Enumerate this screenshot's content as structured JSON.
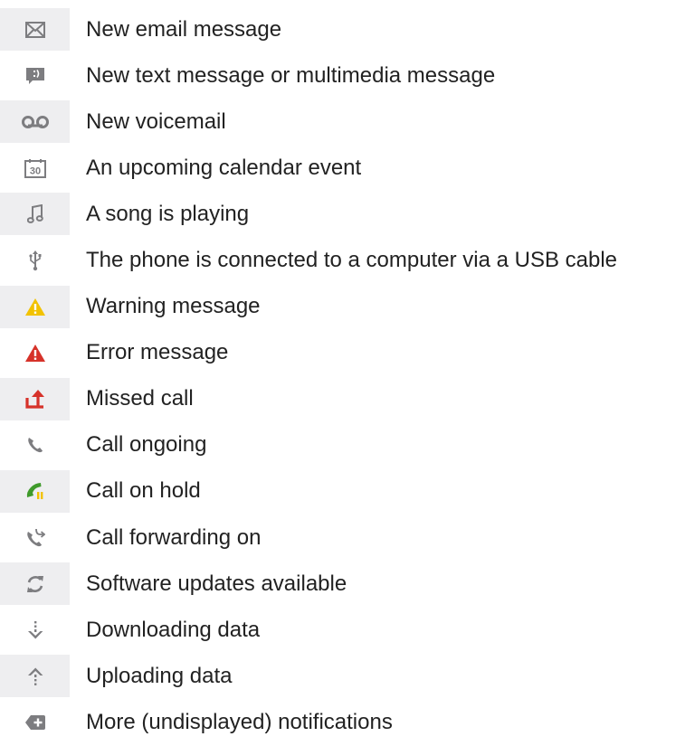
{
  "colors": {
    "icon_gray": "#7d7d80",
    "warning_yellow": "#f2c200",
    "error_red": "#d6322a",
    "hold_green": "#3f9a2b",
    "cell_background": "#eeeef0",
    "text": "#222222"
  },
  "notifications": [
    {
      "icon": "email-icon",
      "label": "New email message"
    },
    {
      "icon": "text-message-icon",
      "label": "New text message or multimedia message"
    },
    {
      "icon": "voicemail-icon",
      "label": "New voicemail"
    },
    {
      "icon": "calendar-icon",
      "label": "An upcoming calendar event",
      "icon_text": "30"
    },
    {
      "icon": "music-note-icon",
      "label": "A song is playing"
    },
    {
      "icon": "usb-icon",
      "label": "The phone is connected to a computer via a USB cable"
    },
    {
      "icon": "warning-icon",
      "label": "Warning message"
    },
    {
      "icon": "error-icon",
      "label": "Error message"
    },
    {
      "icon": "missed-call-icon",
      "label": "Missed call"
    },
    {
      "icon": "call-ongoing-icon",
      "label": "Call ongoing"
    },
    {
      "icon": "call-on-hold-icon",
      "label": "Call on hold"
    },
    {
      "icon": "call-forwarding-icon",
      "label": "Call forwarding on"
    },
    {
      "icon": "software-update-icon",
      "label": "Software updates available"
    },
    {
      "icon": "download-icon",
      "label": "Downloading data"
    },
    {
      "icon": "upload-icon",
      "label": "Uploading data"
    },
    {
      "icon": "more-notifications-icon",
      "label": "More (undisplayed) notifications"
    }
  ]
}
